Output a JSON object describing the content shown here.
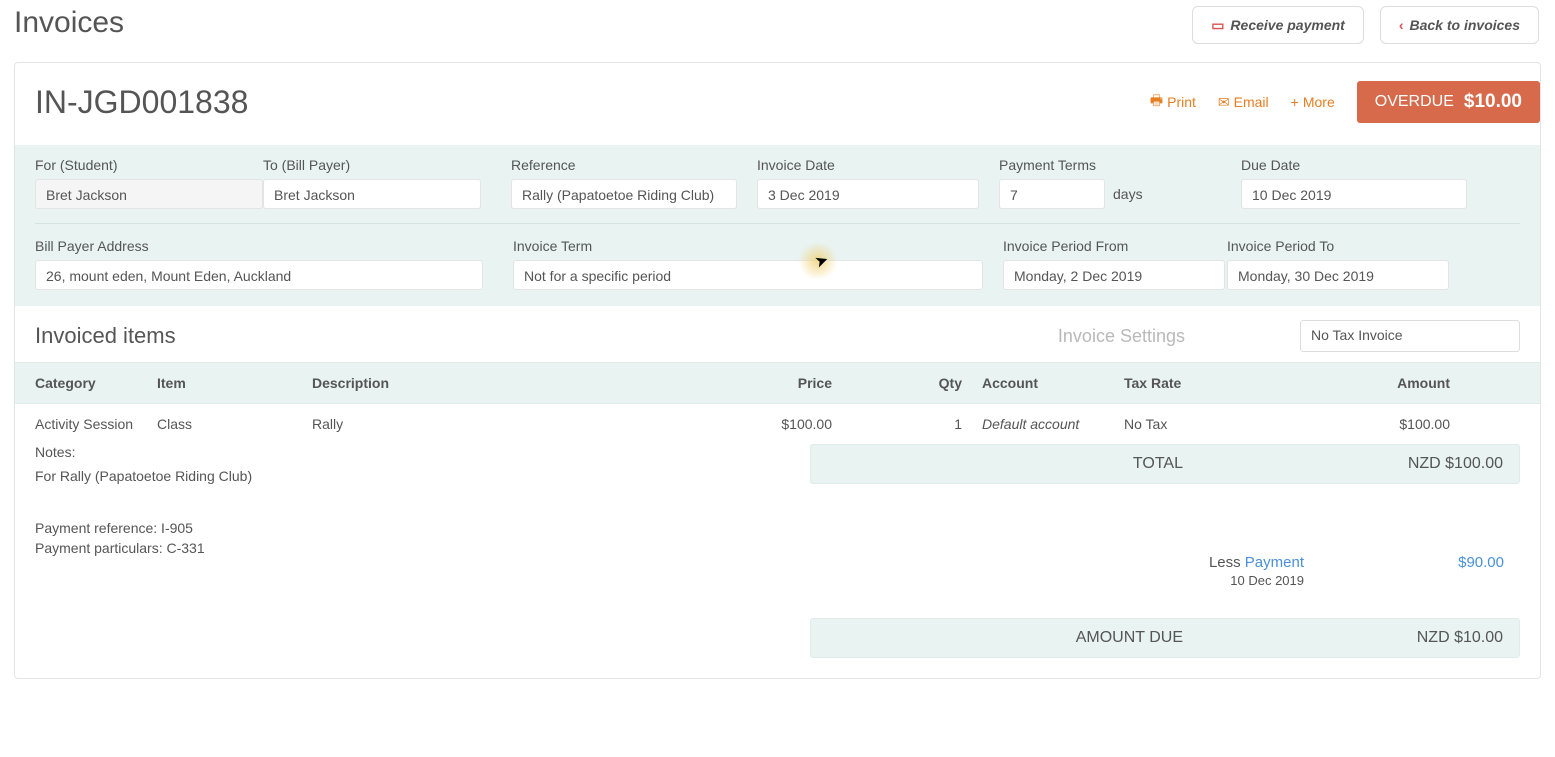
{
  "header": {
    "page_title": "Invoices",
    "receive_payment_label": "Receive payment",
    "back_label": "Back to invoices"
  },
  "invoice": {
    "number": "IN-JGD001838",
    "actions": {
      "print": "Print",
      "email": "Email",
      "more": "More"
    },
    "status_label": "OVERDUE",
    "status_amount": "$10.00"
  },
  "summary": {
    "labels": {
      "for": "For (Student)",
      "to": "To (Bill Payer)",
      "reference": "Reference",
      "invoice_date": "Invoice Date",
      "payment_terms": "Payment Terms",
      "days": "days",
      "due_date": "Due Date",
      "bill_payer_address": "Bill Payer Address",
      "invoice_term": "Invoice Term",
      "period_from": "Invoice Period From",
      "period_to": "Invoice Period To"
    },
    "values": {
      "for": "Bret Jackson",
      "to": "Bret Jackson",
      "reference": "Rally (Papatoetoe Riding Club)",
      "invoice_date": "3 Dec 2019",
      "payment_terms_days": "7",
      "due_date": "10 Dec 2019",
      "bill_payer_address": "26, mount eden, Mount Eden, Auckland",
      "invoice_term": "Not for a specific period",
      "period_from": "Monday, 2 Dec 2019",
      "period_to": "Monday, 30 Dec 2019"
    }
  },
  "items_section": {
    "title": "Invoiced items",
    "settings_label": "Invoice Settings",
    "tax_selector": "No Tax Invoice",
    "columns": {
      "category": "Category",
      "item": "Item",
      "description": "Description",
      "price": "Price",
      "qty": "Qty",
      "account": "Account",
      "tax_rate": "Tax Rate",
      "amount": "Amount"
    },
    "rows": [
      {
        "category": "Activity Session",
        "item": "Class",
        "description": "Rally",
        "price": "$100.00",
        "qty": "1",
        "account": "Default account",
        "tax_rate": "No Tax",
        "amount": "$100.00"
      }
    ]
  },
  "notes": {
    "label": "Notes:",
    "body": "For Rally (Papatoetoe Riding Club)",
    "payment_reference": "Payment reference: I-905",
    "payment_particulars": "Payment particulars: C-331"
  },
  "totals": {
    "total_label": "TOTAL",
    "total_value": "NZD $100.00",
    "less_label": "Less ",
    "payment_link": "Payment",
    "payment_date": "10 Dec 2019",
    "payment_amount": "$90.00",
    "due_label": "AMOUNT DUE",
    "due_value": "NZD $10.00"
  }
}
